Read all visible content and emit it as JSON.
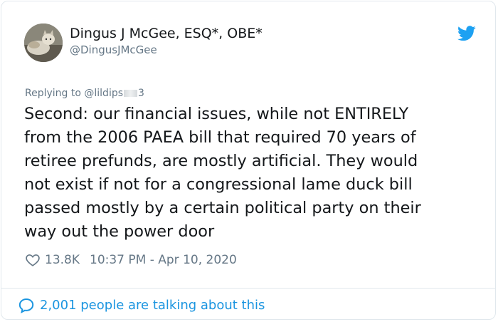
{
  "author": {
    "name": "Dingus J McGee, ESQ*, OBE*",
    "handle": "@DingusJMcGee",
    "avatar_icon": "avatar-cat-photo"
  },
  "platform_icon": "twitter-bird-icon",
  "reply": {
    "prefix": "Replying to ",
    "handle_start": "@lildips",
    "handle_end": "3"
  },
  "tweet": {
    "lines": [
      "Second: our financial issues, while not ENTIRELY",
      "from the 2006 PAEA bill that required 70 years of",
      "retiree prefunds, are mostly artificial. They would",
      "not exist if not for a congressional lame duck bill",
      "passed mostly by a certain political party on their",
      "way out the power door"
    ]
  },
  "meta": {
    "likes": "13.8K",
    "timestamp": "10:37 PM - Apr 10, 2020"
  },
  "footer": {
    "talking": "2,001 people are talking about this"
  },
  "colors": {
    "text": "#14171a",
    "secondary": "#657786",
    "link": "#1b95e0",
    "border": "#e1e8ed"
  }
}
